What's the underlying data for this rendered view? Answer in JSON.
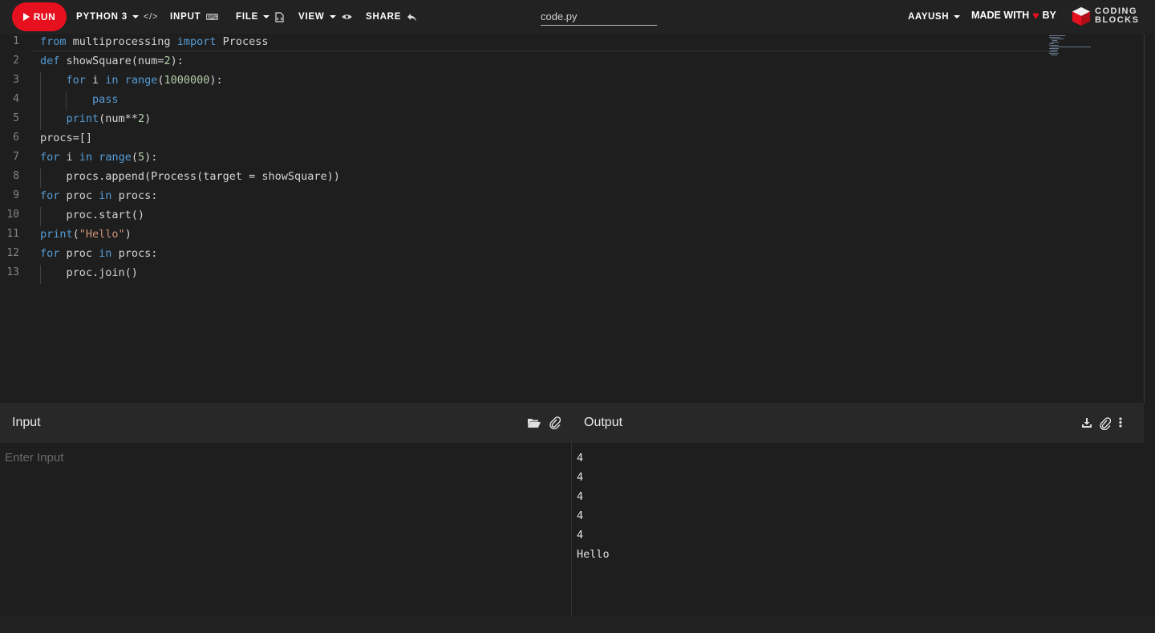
{
  "navbar": {
    "run_label": "RUN",
    "language_label": "PYTHON 3",
    "input_label": "INPUT",
    "file_label": "FILE",
    "view_label": "VIEW",
    "share_label": "SHARE",
    "filename_value": "code.py",
    "user_label": "AAYUSH",
    "made_with_label": "MADE WITH",
    "by_label": "BY",
    "brand_line1": "CODING",
    "brand_line2": "BLOCKS"
  },
  "editor": {
    "line_numbers": [
      "1",
      "2",
      "3",
      "4",
      "5",
      "6",
      "7",
      "8",
      "9",
      "10",
      "11",
      "12",
      "13"
    ],
    "lines": [
      "from multiprocessing import Process",
      "def showSquare(num=2):",
      "    for i in range(1000000):",
      "        pass",
      "    print(num**2)",
      "procs=[]",
      "for i in range(5):",
      "    procs.append(Process(target = showSquare))",
      "for proc in procs:",
      "    proc.start()",
      "print(\"Hello\")",
      "for proc in procs:",
      "    proc.join()"
    ]
  },
  "input_panel": {
    "title": "Input",
    "placeholder": "Enter Input",
    "value": ""
  },
  "output_panel": {
    "title": "Output",
    "lines": [
      "4",
      "4",
      "4",
      "4",
      "4",
      "Hello"
    ]
  },
  "colors": {
    "run_button": "#e6101e",
    "keyword": "#569cd6",
    "number": "#b5cea8",
    "string": "#ce9178",
    "background": "#1e1e1e"
  }
}
